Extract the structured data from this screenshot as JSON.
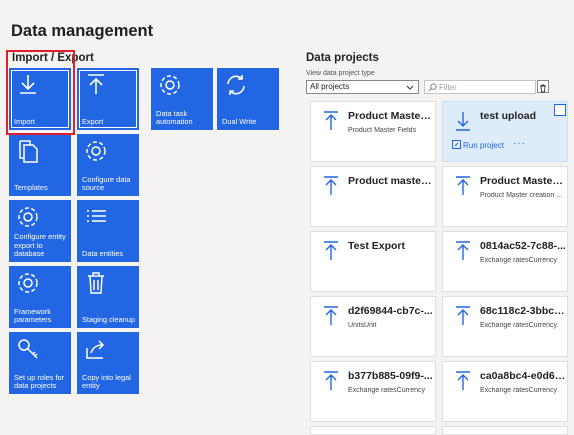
{
  "page": {
    "title": "Data management"
  },
  "import_export": {
    "heading": "Import / Export",
    "tiles": [
      {
        "label": "Import",
        "icon": "import-arrow-icon"
      },
      {
        "label": "Export",
        "icon": "export-arrow-icon"
      },
      {
        "label": "Data task automation",
        "icon": "gear-icon"
      },
      {
        "label": "Dual Write",
        "icon": "refresh-icon"
      },
      {
        "label": "Templates",
        "icon": "copy-icon"
      },
      {
        "label": "Configure data source",
        "icon": "gear-icon"
      },
      {
        "label": "Configure entity export to database",
        "icon": "gear-icon"
      },
      {
        "label": "Data entities",
        "icon": "list-icon"
      },
      {
        "label": "Framework parameters",
        "icon": "gear-icon"
      },
      {
        "label": "Staging cleanup",
        "icon": "trash-icon"
      },
      {
        "label": "Set up roles for data projects",
        "icon": "key-icon"
      },
      {
        "label": "Copy into legal entity",
        "icon": "share-icon"
      }
    ]
  },
  "projects": {
    "heading": "Data projects",
    "filter_label": "View data project type",
    "type_selected": "All projects",
    "filter_placeholder": "Filter",
    "run_label": "Run project",
    "more_label": "···",
    "cards": [
      {
        "name": "Product Master ...",
        "desc": "Product Master Fields",
        "icon": "export-arrow-icon"
      },
      {
        "name": "test upload",
        "desc": "",
        "icon": "import-arrow-icon"
      },
      {
        "name": "Product master ...",
        "desc": "",
        "icon": "export-arrow-icon"
      },
      {
        "name": "Product Master ...",
        "desc": "Product Master creation ...",
        "icon": "export-arrow-icon"
      },
      {
        "name": "Test Export",
        "desc": "",
        "icon": "export-arrow-icon"
      },
      {
        "name": "0814ac52-7c88-...",
        "desc": "Exchange ratesCurrency",
        "icon": "export-arrow-icon"
      },
      {
        "name": "d2f69844-cb7c-...",
        "desc": "UnitsUnit",
        "icon": "export-arrow-icon"
      },
      {
        "name": "68c118c2-3bbc-...",
        "desc": "Exchange ratesCurrency",
        "icon": "export-arrow-icon"
      },
      {
        "name": "b377b885-09f9-...",
        "desc": "Exchange ratesCurrency",
        "icon": "export-arrow-icon"
      },
      {
        "name": "ca0a8bc4-e0d6-...",
        "desc": "Exchange ratesCurrency",
        "icon": "export-arrow-icon"
      }
    ]
  },
  "colors": {
    "tile": "#2266e3",
    "highlight": "#e01f2d",
    "card_active": "#deecf9"
  }
}
